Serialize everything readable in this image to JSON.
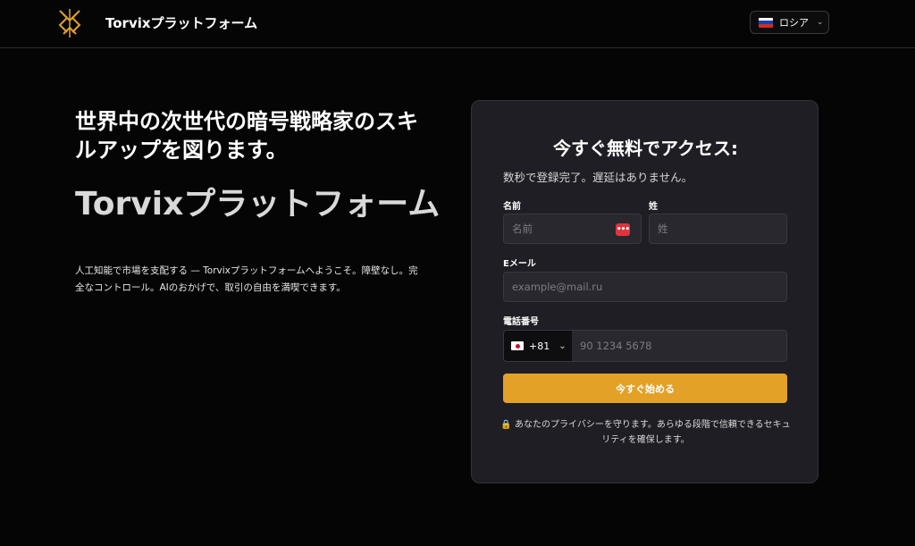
{
  "header": {
    "brand": "Torvixプラットフォーム",
    "language": "ロシア",
    "language_flag_icon": "flag-russia-icon"
  },
  "hero": {
    "title": "世界中の次世代の暗号戦略家のスキルアップを図ります。",
    "brand": "Torvixプラットフォーム",
    "description": "人工知能で市場を支配する — Torvixプラットフォームへようこそ。障壁なし。完全なコントロール。AIのおかげで、取引の自由を満喫できます。"
  },
  "form": {
    "title": "今すぐ無料でアクセス:",
    "subtitle": "数秒で登録完了。遅延はありません。",
    "first_name": {
      "label": "名前",
      "placeholder": "名前",
      "value": ""
    },
    "last_name": {
      "label": "姓",
      "placeholder": "姓",
      "value": ""
    },
    "email": {
      "label": "Eメール",
      "placeholder": "example@mail.ru",
      "value": ""
    },
    "phone": {
      "label": "電話番号",
      "country_code": "+81",
      "country_flag_icon": "flag-japan-icon",
      "placeholder": "90 1234 5678",
      "value": ""
    },
    "submit_label": "今すぐ始める",
    "privacy_text": "あなたのプライバシーを守ります。あらゆる段階で信頼できるセキュリティを確保します。"
  },
  "colors": {
    "background": "#050505",
    "card": "#1f1e24",
    "accent": "#e3a128",
    "input": "#29282e"
  }
}
